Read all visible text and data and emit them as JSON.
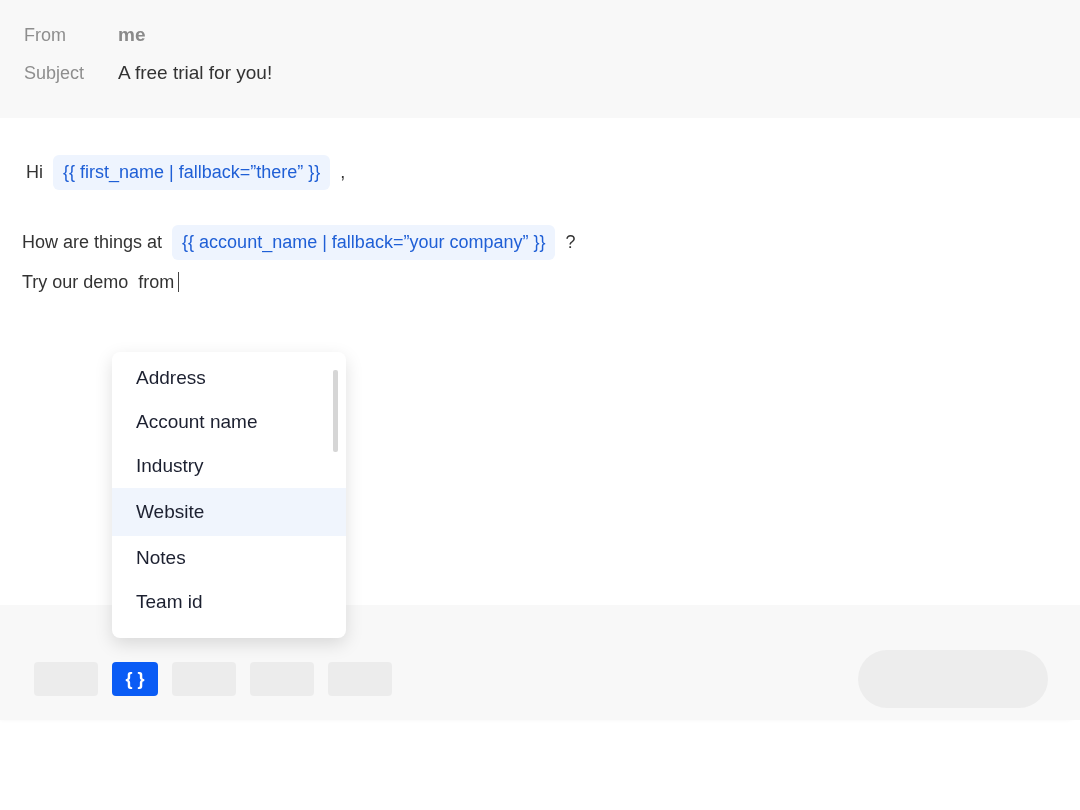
{
  "header": {
    "fields": [
      {
        "label": "From",
        "value": "me",
        "kind": "muted"
      },
      {
        "label": "Subject",
        "value": "A free trial for you!",
        "kind": "strong"
      }
    ]
  },
  "body": {
    "lines": [
      {
        "segments": [
          {
            "kind": "text",
            "text": "Hi"
          },
          {
            "kind": "variable",
            "text": "{{ first_name | fallback=”there” }}"
          },
          {
            "kind": "text",
            "text": ","
          }
        ],
        "cursor": false
      },
      {
        "segments": [
          {
            "kind": "text",
            "text": "How are things at"
          },
          {
            "kind": "variable",
            "text": "{{ account_name | fallback=”your company” }}"
          },
          {
            "kind": "text",
            "text": "?"
          }
        ],
        "cursor": false
      },
      {
        "segments": [
          {
            "kind": "text",
            "text": "Try our demo  from"
          }
        ],
        "cursor": true
      }
    ]
  },
  "dropdown": {
    "items": [
      {
        "label": "Address",
        "selected": false
      },
      {
        "label": "Account name",
        "selected": false
      },
      {
        "label": "Industry",
        "selected": false
      },
      {
        "label": "Website",
        "selected": true
      },
      {
        "label": "Notes",
        "selected": false
      },
      {
        "label": "Team id",
        "selected": false
      }
    ]
  },
  "toolbar": {
    "buttons": [
      {
        "kind": "blank",
        "selected": false
      },
      {
        "kind": "variable",
        "label": "{ }",
        "selected": true
      },
      {
        "kind": "blank",
        "selected": false
      },
      {
        "kind": "blank",
        "selected": false
      },
      {
        "kind": "blank",
        "selected": false
      }
    ]
  }
}
